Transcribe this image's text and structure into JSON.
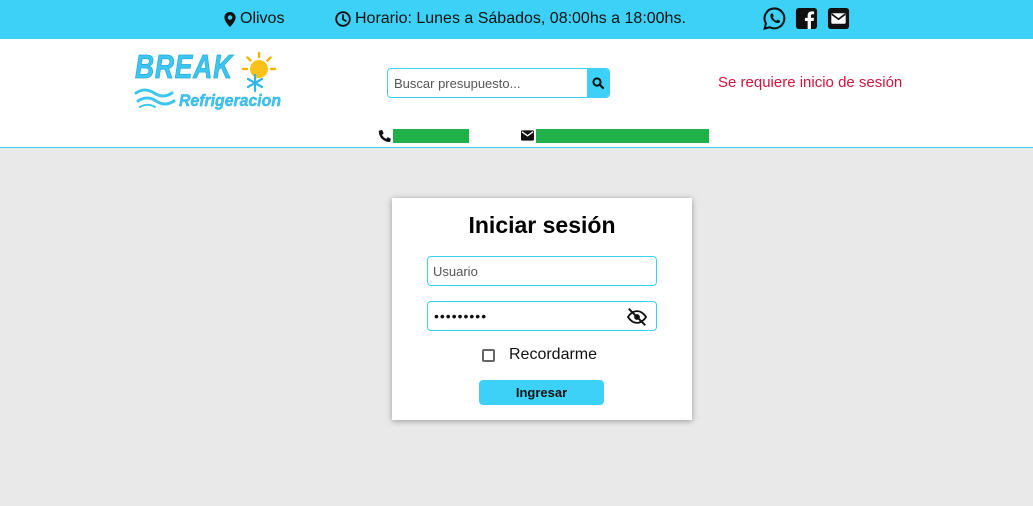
{
  "topbar": {
    "location": "Olivos",
    "schedule": "Horario: Lunes a Sábados, 08:00hs a 18:00hs.",
    "icons": [
      "map-marker-icon",
      "clock-icon",
      "whatsapp-icon",
      "facebook-icon",
      "envelope-icon"
    ]
  },
  "header": {
    "logo_line1": "BREAK",
    "logo_line2": "Refrigeracion",
    "search_placeholder": "Buscar presupuesto...",
    "login_required": "Se requiere inicio de sesión",
    "contact_icons": [
      "phone-icon",
      "envelope-icon"
    ]
  },
  "login": {
    "title": "Iniciar sesión",
    "username_placeholder": "Usuario",
    "password_mask": "•••••••••",
    "remember_label": "Recordarme",
    "remember_checked": false,
    "submit_label": "Ingresar"
  },
  "colors": {
    "accent": "#3dd1f8",
    "alert": "#d0143c",
    "contact_bar": "#21b14b",
    "background": "#e9e9e9"
  }
}
